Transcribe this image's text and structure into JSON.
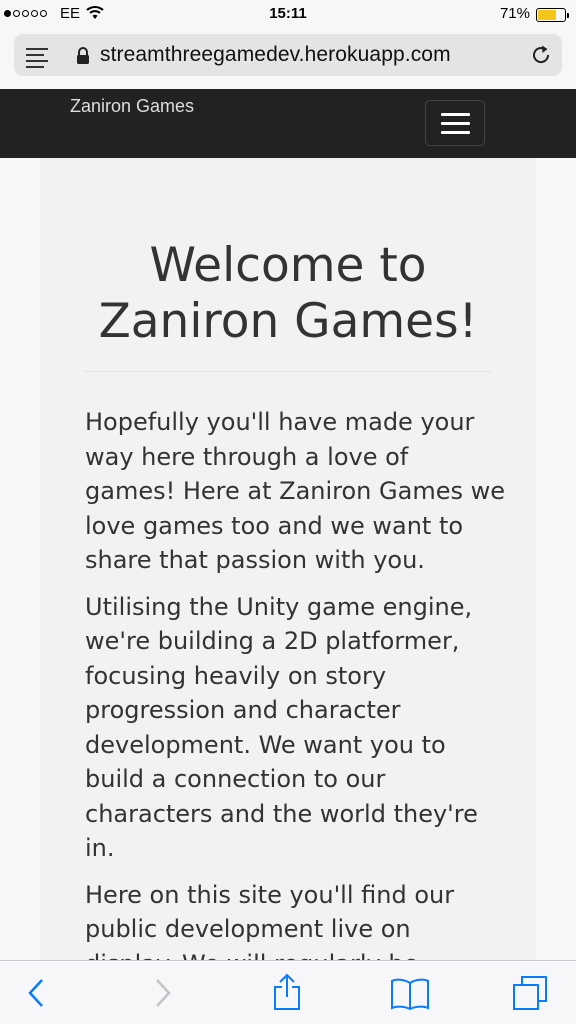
{
  "status_bar": {
    "carrier": "EE",
    "time": "15:11",
    "battery_percent_label": "71%",
    "battery_level": 0.71,
    "signal_bars_filled": 1,
    "signal_bars_total": 5
  },
  "browser": {
    "url": "streamthreegamedev.herokuapp.com",
    "reader_icon": "reader-mode-icon",
    "lock_icon": "lock-icon",
    "reload_icon": "reload-icon"
  },
  "navbar": {
    "brand": "Zaniron Games",
    "toggle_icon": "hamburger-icon"
  },
  "main": {
    "heading_line1": "Welcome to",
    "heading_line2": "Zaniron Games!",
    "paragraphs": [
      "Hopefully you'll have made your way here through a love of games! Here at Zaniron Games we love games too and we want to share that passion with you.",
      "Utilising the Unity game engine, we're building a 2D platformer, focusing heavily on story progression and character development. We want you to build a connection to our characters and the world they're in.",
      "Here on this site you'll find our public development live on display. We will regularly be"
    ]
  },
  "toolbar": {
    "back_icon": "back-chevron-icon",
    "forward_icon": "forward-chevron-icon",
    "share_icon": "share-icon",
    "bookmarks_icon": "bookmarks-icon",
    "tabs_icon": "tabs-icon"
  },
  "colors": {
    "navbar_bg": "#222222",
    "accent_blue": "#0a7aff",
    "battery_yellow": "#f5c518"
  }
}
